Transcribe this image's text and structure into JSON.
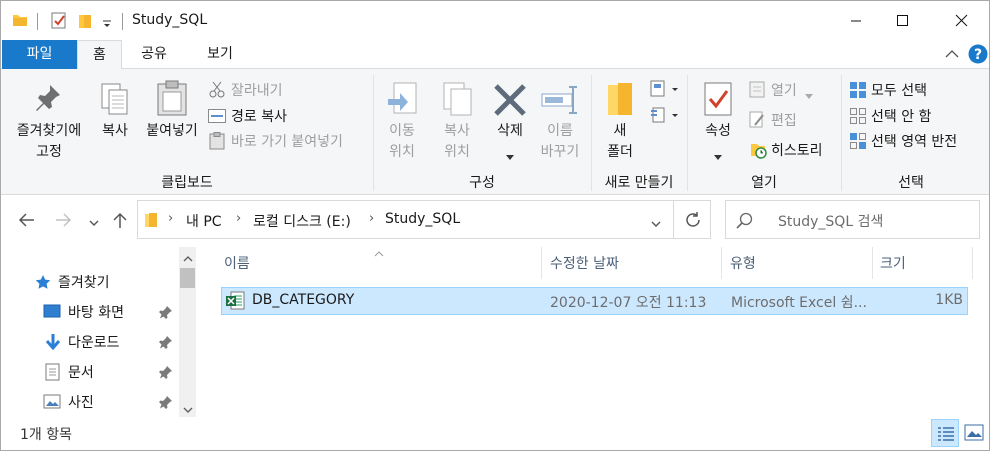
{
  "window": {
    "title": "Study_SQL"
  },
  "tabs": {
    "file": "파일",
    "home": "홈",
    "share": "공유",
    "view": "보기"
  },
  "ribbon": {
    "clipboard": {
      "pin_l1": "즐겨찾기에",
      "pin_l2": "고정",
      "copy": "복사",
      "paste": "붙여넣기",
      "cut": "잘라내기",
      "copy_path": "경로 복사",
      "paste_shortcut": "바로 가기 붙여넣기",
      "label": "클립보드"
    },
    "organize": {
      "move_l1": "이동",
      "move_l2": "위치",
      "copyto_l1": "복사",
      "copyto_l2": "위치",
      "delete": "삭제",
      "rename_l1": "이름",
      "rename_l2": "바꾸기",
      "label": "구성"
    },
    "new": {
      "folder_l1": "새",
      "folder_l2": "폴더",
      "label": "새로 만들기"
    },
    "open": {
      "properties": "속성",
      "open": "열기",
      "edit": "편집",
      "history": "히스토리",
      "label": "열기"
    },
    "select": {
      "select_all": "모두 선택",
      "select_none": "선택 안 함",
      "invert": "선택 영역 반전",
      "label": "선택"
    }
  },
  "address": {
    "segments": [
      "내 PC",
      "로컬 디스크 (E:)",
      "Study_SQL"
    ],
    "search_placeholder": "Study_SQL 검색"
  },
  "nav": {
    "quick_access": "즐겨찾기",
    "items": [
      {
        "label": "바탕 화면"
      },
      {
        "label": "다운로드"
      },
      {
        "label": "문서"
      },
      {
        "label": "사진"
      }
    ]
  },
  "columns": {
    "name": "이름",
    "modified": "수정한 날짜",
    "type": "유형",
    "size": "크기"
  },
  "files": [
    {
      "name": "DB_CATEGORY",
      "modified": "2020-12-07 오전 11:13",
      "type": "Microsoft Excel 쉼...",
      "size": "1KB"
    }
  ],
  "status": {
    "count": "1개 항목"
  },
  "colors": {
    "accent": "#1979ca",
    "selection": "#cce8ff",
    "folder": "#ffc83d"
  }
}
